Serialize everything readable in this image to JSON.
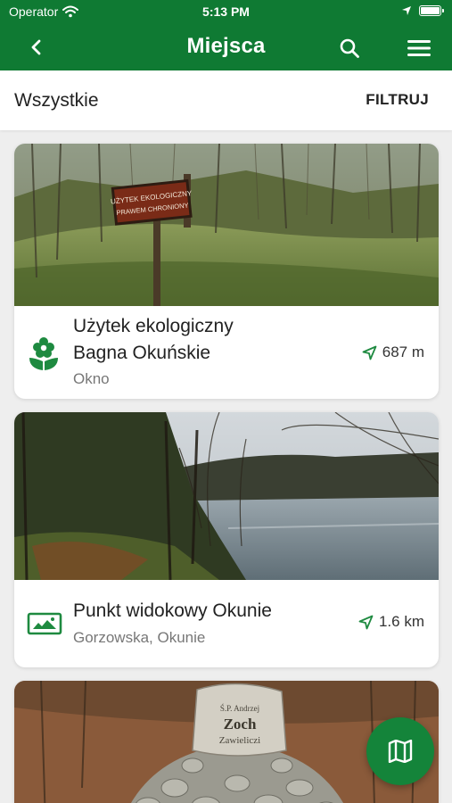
{
  "status_bar": {
    "carrier": "Operator",
    "time": "5:13 PM"
  },
  "nav": {
    "title": "Miejsca"
  },
  "filter_bar": {
    "label": "Wszystkie",
    "filter_button": "FILTRUJ"
  },
  "places": [
    {
      "title_line1": "Użytek ekologiczny",
      "title_line2": "Bagna Okuńskie",
      "address": "Okno",
      "distance": "687 m",
      "category_icon": "flower-icon",
      "sign_line1": "UŻYTEK EKOLOGICZNY",
      "sign_line2": "PRAWEM CHRONIONY"
    },
    {
      "title": "Punkt widokowy Okunie",
      "address": "Gorzowska,  Okunie",
      "distance": "1.6 km",
      "category_icon": "panorama-icon"
    },
    {
      "stone_line1": "Ś.P. Andrzej",
      "stone_line2": "Zoch",
      "stone_line3": "Zawieliczi"
    }
  ],
  "theme": {
    "primary": "#0f7a33",
    "fab": "#14843a",
    "icon_green": "#1e8a40"
  }
}
